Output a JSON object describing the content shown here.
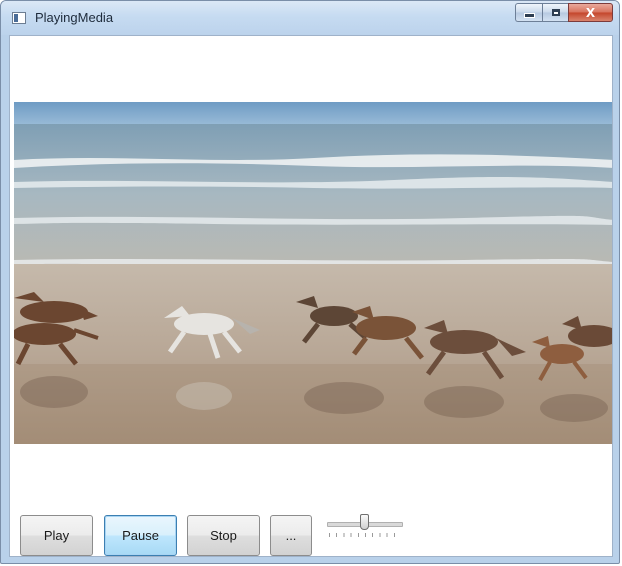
{
  "window": {
    "title": "PlayingMedia",
    "icon": "app-window-icon",
    "caption_buttons": {
      "minimize_icon": "minimize-icon",
      "maximize_icon": "maximize-icon",
      "close_label": "X"
    }
  },
  "media": {
    "content": "video frame: horses galloping on a beach",
    "icon": "media-element"
  },
  "controls": {
    "play_label": "Play",
    "pause_label": "Pause",
    "stop_label": "Stop",
    "browse_label": "...",
    "focused_button": "Pause",
    "volume_slider": {
      "value": 0.5
    }
  },
  "colors": {
    "titlebar": "#c6dbf1",
    "close_button": "#c4452a",
    "focused_button_border": "#3c7fb1"
  }
}
